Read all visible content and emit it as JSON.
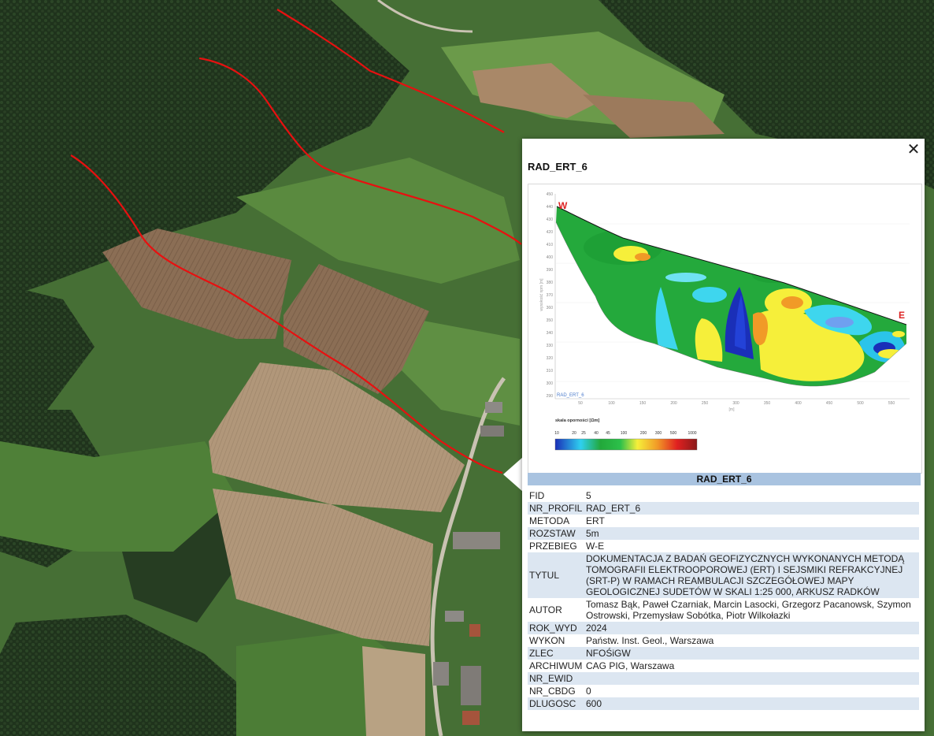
{
  "popup": {
    "title": "RAD_ERT_6",
    "close_icon": "close-icon",
    "subheader": "RAD_ERT_6",
    "attributes": [
      {
        "key": "FID",
        "value": "5"
      },
      {
        "key": "NR_PROFIL",
        "value": "RAD_ERT_6"
      },
      {
        "key": "METODA",
        "value": "ERT"
      },
      {
        "key": "ROZSTAW",
        "value": "5m"
      },
      {
        "key": "PRZEBIEG",
        "value": "W-E"
      },
      {
        "key": "TYTUL",
        "value": "DOKUMENTACJA Z BADAŃ GEOFIZYCZNYCH WYKONANYCH METODĄ TOMOGRAFII ELEKTROOPOROWEJ (ERT) I SEJSMIKI REFRAKCYJNEJ (SRT-P) W RAMACH REAMBULACJI SZCZEGÓŁOWEJ MAPY GEOLOGICZNEJ SUDETÓW W SKALI 1:25 000, ARKUSZ RADKÓW"
      },
      {
        "key": "AUTOR",
        "value": "Tomasz Bąk, Paweł Czarniak, Marcin Lasocki, Grzegorz Pacanowsk, Szymon Ostrowski, Przemysław Sobótka, Piotr Wilkołazki"
      },
      {
        "key": "ROK_WYD",
        "value": "2024"
      },
      {
        "key": "WYKON",
        "value": "Państw. Inst. Geol., Warszawa"
      },
      {
        "key": "ZLEC",
        "value": "NFOŚiGW"
      },
      {
        "key": "ARCHIWUM",
        "value": "CAG PIG, Warszawa"
      },
      {
        "key": "NR_EWID",
        "value": ""
      },
      {
        "key": "NR_CBDG",
        "value": "0"
      },
      {
        "key": "DLUGOSC",
        "value": "600"
      }
    ],
    "profile_image": {
      "label_west": "W",
      "label_east": "E",
      "profile_name": "RAD_ERT_6",
      "ylabel": "wysokość npm [m]",
      "xlabel": "[m]",
      "y_ticks": [
        "450",
        "440",
        "430",
        "420",
        "410",
        "400",
        "390",
        "380",
        "370",
        "360",
        "350",
        "340",
        "330",
        "320",
        "310",
        "300",
        "290"
      ],
      "x_ticks": [
        "50",
        "100",
        "150",
        "200",
        "250",
        "300",
        "350",
        "400",
        "450",
        "500",
        "550"
      ],
      "scale_title": "skala oporności [Ωm]",
      "scale_values": [
        "10",
        "20",
        "25",
        "40",
        "45",
        "100",
        "200",
        "300",
        "500",
        "1000"
      ],
      "colors": {
        "deep_blue": "#1a2fb8",
        "cyan": "#2fd0f0",
        "green": "#22a83a",
        "yellow": "#f6ef3a",
        "orange": "#f19a27",
        "red": "#e02020"
      }
    }
  },
  "map": {
    "line_color": "#e81010",
    "field_colors": {
      "forest": "#23391f",
      "meadow": "#4f7a3a",
      "plowed": "#8a6a4e",
      "stubble": "#b09574"
    }
  }
}
